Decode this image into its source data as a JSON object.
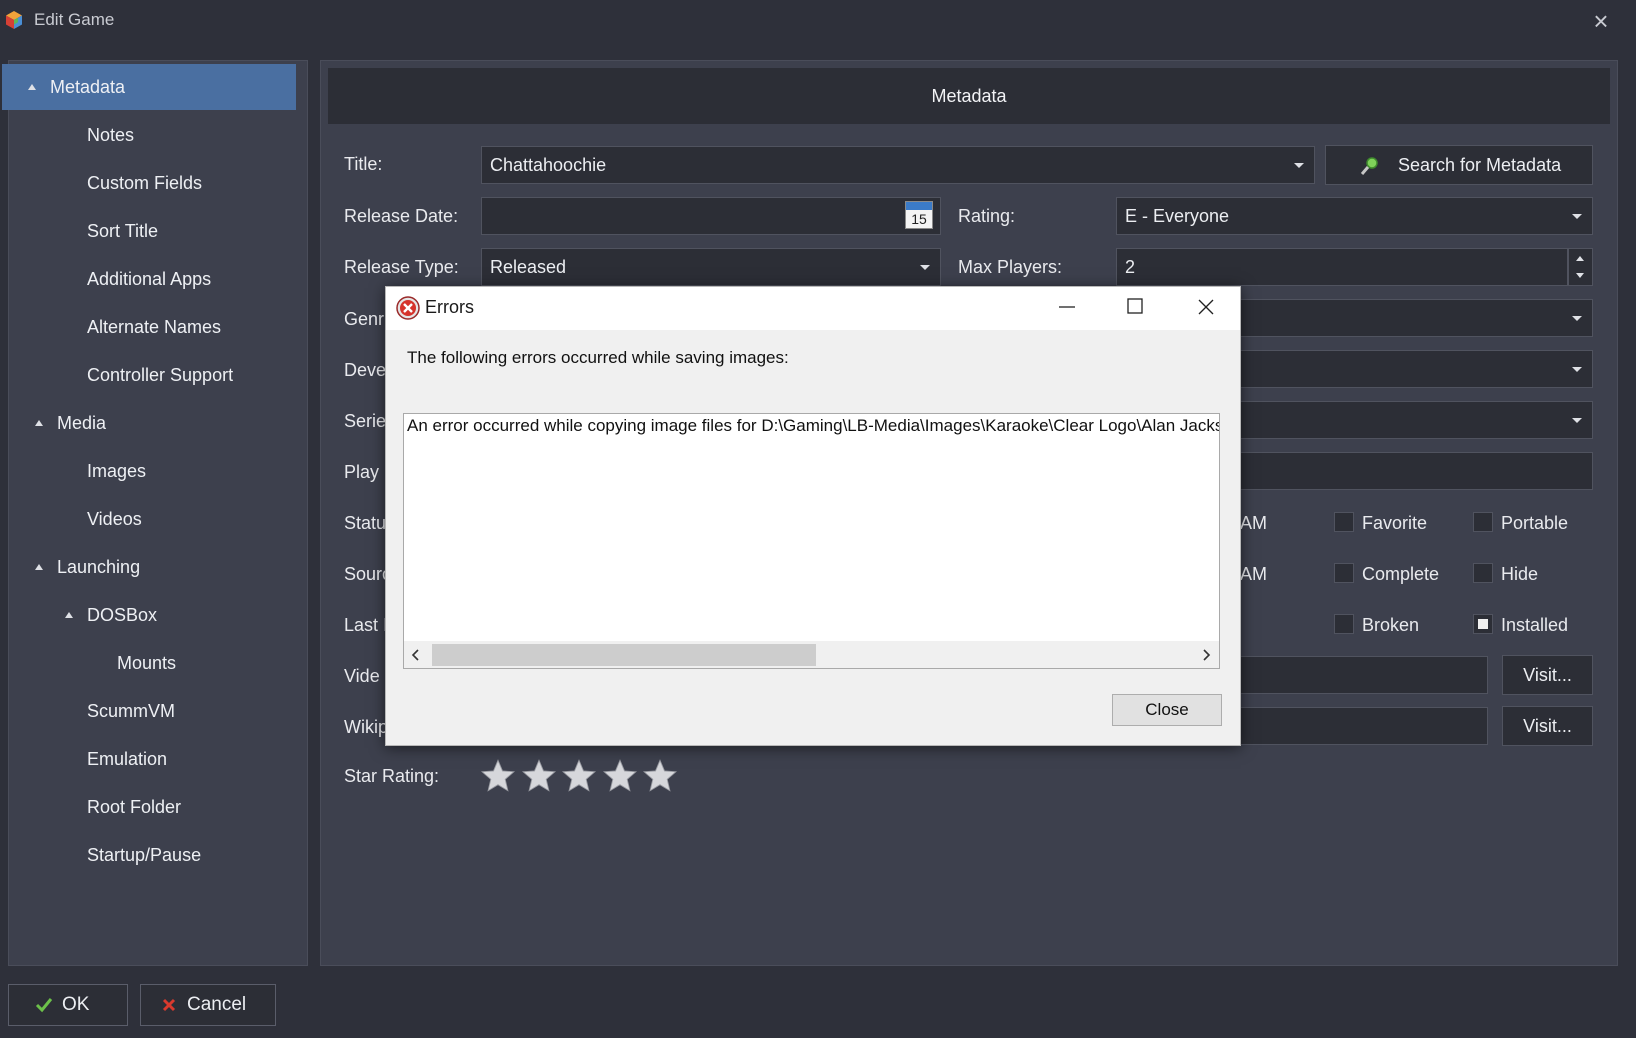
{
  "window": {
    "title": "Edit Game"
  },
  "sidebar": {
    "items": [
      {
        "label": "Metadata",
        "level": 0,
        "expanded": true,
        "selected": true
      },
      {
        "label": "Notes",
        "level": 1
      },
      {
        "label": "Custom Fields",
        "level": 1
      },
      {
        "label": "Sort Title",
        "level": 1
      },
      {
        "label": "Additional Apps",
        "level": 1
      },
      {
        "label": "Alternate Names",
        "level": 1
      },
      {
        "label": "Controller Support",
        "level": 1
      },
      {
        "label": "Media",
        "level": 0,
        "expanded": true
      },
      {
        "label": "Images",
        "level": 1
      },
      {
        "label": "Videos",
        "level": 1
      },
      {
        "label": "Launching",
        "level": 0,
        "expanded": true
      },
      {
        "label": "DOSBox",
        "level": 1,
        "expanded": true
      },
      {
        "label": "Mounts",
        "level": 2
      },
      {
        "label": "ScummVM",
        "level": 1
      },
      {
        "label": "Emulation",
        "level": 1
      },
      {
        "label": "Root Folder",
        "level": 1
      },
      {
        "label": "Startup/Pause",
        "level": 1
      }
    ]
  },
  "content": {
    "header": "Metadata",
    "title_label": "Title:",
    "title_value": "Chattahoochie",
    "search_button": "Search for Metadata",
    "release_date_label": "Release Date:",
    "release_date_value": "",
    "calendar_day": "15",
    "rating_label": "Rating:",
    "rating_value": "E - Everyone",
    "release_type_label": "Release Type:",
    "release_type_value": "Released",
    "max_players_label": "Max Players:",
    "max_players_value": "2",
    "partial_labels": [
      "Genr",
      "Deve",
      "Serie",
      "Play I",
      "Statu",
      "Sourc",
      "Last I",
      "Vide",
      "Wikip"
    ],
    "time_fragments": [
      "AM",
      "AM"
    ],
    "checkboxes": [
      {
        "label": "Favorite",
        "checked": false
      },
      {
        "label": "Portable",
        "checked": false
      },
      {
        "label": "Complete",
        "checked": false
      },
      {
        "label": "Hide",
        "checked": false
      },
      {
        "label": "Broken",
        "checked": false
      },
      {
        "label": "Installed",
        "checked": true
      }
    ],
    "visit_buttons": [
      "Visit...",
      "Visit..."
    ],
    "star_rating_label": "Star Rating:",
    "star_rating": 0,
    "star_count": 5
  },
  "dialog": {
    "title": "Errors",
    "message": "The following errors occurred while saving images:",
    "error_text": "An error occurred while copying image files for D:\\Gaming\\LB-Media\\Images\\Karaoke\\Clear Logo\\Alan Jackso",
    "close_button": "Close"
  },
  "footer": {
    "ok_label": "OK",
    "cancel_label": "Cancel"
  },
  "colors": {
    "background": "#2e303a",
    "panel": "#3d404d",
    "field": "#2c2e36",
    "selected": "#4a6fa1"
  }
}
